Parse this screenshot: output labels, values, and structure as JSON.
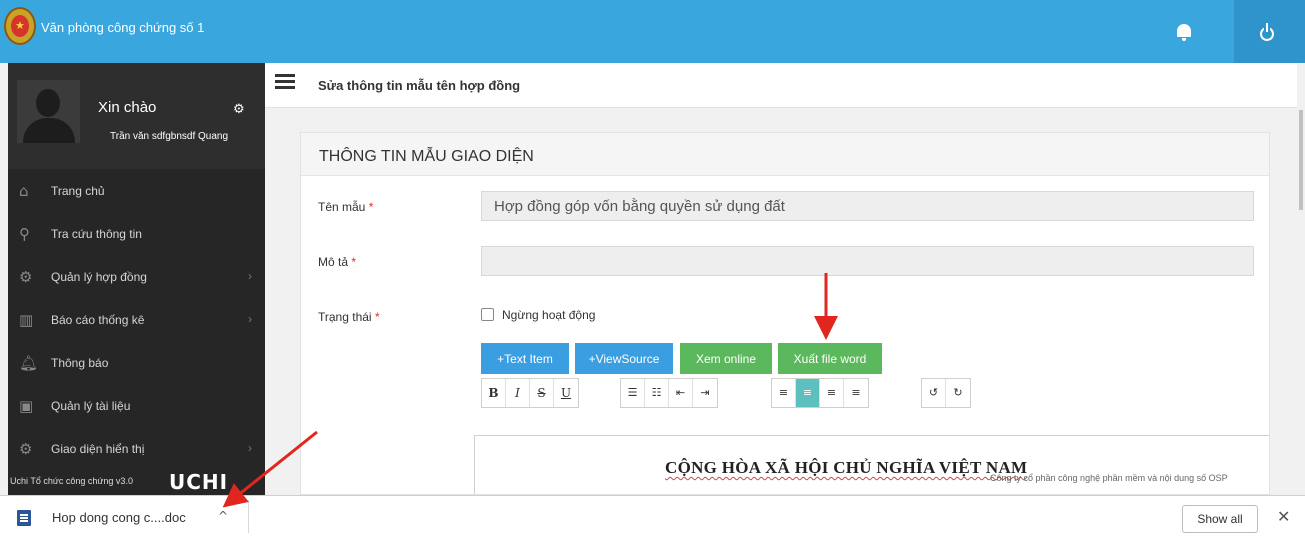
{
  "app": {
    "title": "Văn phòng công chứng số 1"
  },
  "profile": {
    "greeting": "Xin chào",
    "username": "Trần văn sdfgbnsdf Quang"
  },
  "sidebar": {
    "items": [
      {
        "label": "Trang chủ",
        "icon": "home-icon",
        "glyph": "⌂",
        "has_submenu": false
      },
      {
        "label": "Tra cứu thông tin",
        "icon": "search-icon",
        "glyph": "⚲",
        "has_submenu": false
      },
      {
        "label": "Quản lý hợp đồng",
        "icon": "settings-icon",
        "glyph": "⚙",
        "has_submenu": true
      },
      {
        "label": "Báo cáo thống kê",
        "icon": "bar-chart-icon",
        "glyph": "▥",
        "has_submenu": true
      },
      {
        "label": "Thông báo",
        "icon": "bell-icon",
        "glyph": "♫",
        "has_submenu": false
      },
      {
        "label": "Quản lý tài liệu",
        "icon": "book-icon",
        "glyph": "▯",
        "has_submenu": false
      },
      {
        "label": "Giao diện hiển thị",
        "icon": "settings-icon",
        "glyph": "⚙",
        "has_submenu": true
      }
    ],
    "footer": {
      "version": "Uchi Tổ chức công chứng v3.0",
      "brand": "UCHI"
    }
  },
  "header": {
    "page_title": "Sửa thông tin mẫu tên hợp đồng"
  },
  "panel": {
    "title": "THÔNG TIN MẪU GIAO DIỆN"
  },
  "form": {
    "name_label": "Tên mẫu",
    "name_value": "Hợp đồng góp vốn bằng quyền sử dụng đất",
    "desc_label": "Mô tả",
    "desc_value": "",
    "status_label": "Trạng thái",
    "status_checkbox_label": "Ngừng hoạt động",
    "status_checked": false,
    "required_mark": "*"
  },
  "actions": {
    "text_item": "+Text Item",
    "view_source": "+ViewSource",
    "view_online": "Xem online",
    "export_word": "Xuất file word"
  },
  "editor": {
    "heading": "CỘNG HÒA XÃ HỘI CHỦ NGHĨA VIỆT NAM",
    "footer_note": "Công ty cổ phần công nghệ phần mềm và nội dung số OSP"
  },
  "toolbar": {
    "bold": "B",
    "italic": "I",
    "strike": "S",
    "underline": "U",
    "bullets": "☰",
    "numbers": "☷",
    "outdent": "⇤",
    "indent": "⇥",
    "align_left": "≡",
    "align_center": "≡",
    "align_right": "≡",
    "justify": "≡",
    "undo": "↺",
    "redo": "↻"
  },
  "download_bar": {
    "file_name": "Hop dong cong c....doc",
    "show_all": "Show all",
    "close": "✕"
  },
  "colors": {
    "topbar": "#3aa6de",
    "sidebar": "#262626",
    "btn_blue": "#3a9ee0",
    "btn_green": "#5cb85c",
    "annotation_arrow": "#e0261f"
  }
}
